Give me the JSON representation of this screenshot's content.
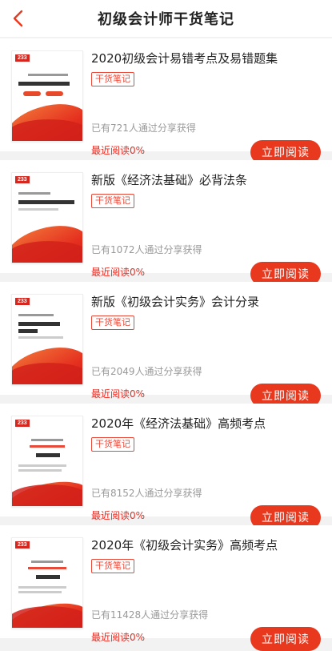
{
  "header": {
    "title": "初级会计师干货笔记"
  },
  "items": [
    {
      "title": "2020初级会计易错考点及易错题集",
      "badge": "干货笔记",
      "shared": "已有721人通过分享获得",
      "recent": "最近阅读0%",
      "button": "立即阅读"
    },
    {
      "title": "新版《经济法基础》必背法条",
      "badge": "干货笔记",
      "shared": "已有1072人通过分享获得",
      "recent": "最近阅读0%",
      "button": "立即阅读"
    },
    {
      "title": "新版《初级会计实务》会计分录",
      "badge": "干货笔记",
      "shared": "已有2049人通过分享获得",
      "recent": "最近阅读0%",
      "button": "立即阅读"
    },
    {
      "title": "2020年《经济法基础》高频考点",
      "badge": "干货笔记",
      "shared": "已有8152人通过分享获得",
      "recent": "最近阅读0%",
      "button": "立即阅读"
    },
    {
      "title": "2020年《初级会计实务》高频考点",
      "badge": "干货笔记",
      "shared": "已有11428人通过分享获得",
      "recent": "最近阅读0%",
      "button": "立即阅读"
    }
  ],
  "icons": {
    "back": "chevron-left-icon"
  },
  "colors": {
    "accent": "#e8391f",
    "badge": "#e84a3a",
    "background": "#f2f2f2"
  }
}
